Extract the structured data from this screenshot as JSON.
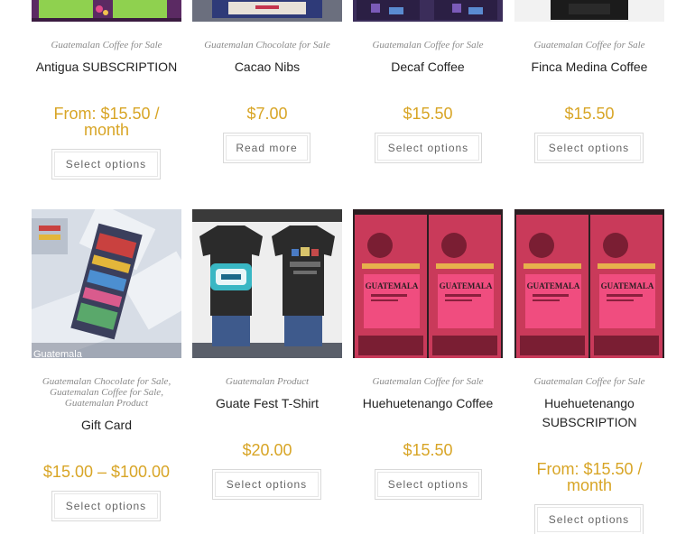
{
  "row1": [
    {
      "categories": "Guatemalan Coffee for Sale",
      "title": "Antigua SUBSCRIPTION",
      "price_line1": "From: $15.50 /",
      "price_line2": "month",
      "button": "Select options"
    },
    {
      "categories": "Guatemalan Chocolate for Sale",
      "title": "Cacao Nibs",
      "price_line1": "$7.00",
      "price_line2": "",
      "button": "Read more"
    },
    {
      "categories": "Guatemalan Coffee for Sale",
      "title": "Decaf Coffee",
      "price_line1": "$15.50",
      "price_line2": "",
      "button": "Select options"
    },
    {
      "categories": "Guatemalan Coffee for Sale",
      "title": "Finca Medina Coffee",
      "price_line1": "$15.50",
      "price_line2": "",
      "button": "Select options"
    }
  ],
  "row2": [
    {
      "categories": [
        "Guatemalan Chocolate for Sale",
        "Guatemalan Coffee for Sale",
        "Guatemalan Product"
      ],
      "title": "Gift Card",
      "price_line1": "$15.00 – $100.00",
      "price_line2": "",
      "button": "Select options",
      "image_caption": "Guatemala"
    },
    {
      "categories": [
        "Guatemalan Product"
      ],
      "title": "Guate Fest T-Shirt",
      "price_line1": "$20.00",
      "price_line2": "",
      "button": "Select options"
    },
    {
      "categories": [
        "Guatemalan Coffee for Sale"
      ],
      "title": "Huehuetenango Coffee",
      "price_line1": "$15.50",
      "price_line2": "",
      "button": "Select options",
      "bag_text": "GUATEMALA"
    },
    {
      "categories": [
        "Guatemalan Coffee for Sale"
      ],
      "title_line1": "Huehuetenango",
      "title_line2": "SUBSCRIPTION",
      "price_line1": "From: $15.50 /",
      "price_line2": "month",
      "button": "Select options",
      "bag_text": "GUATEMALA"
    }
  ],
  "colors": {
    "price": "#d8a526",
    "category": "#8a8a8a",
    "title": "#222222",
    "button_text": "#666666"
  }
}
